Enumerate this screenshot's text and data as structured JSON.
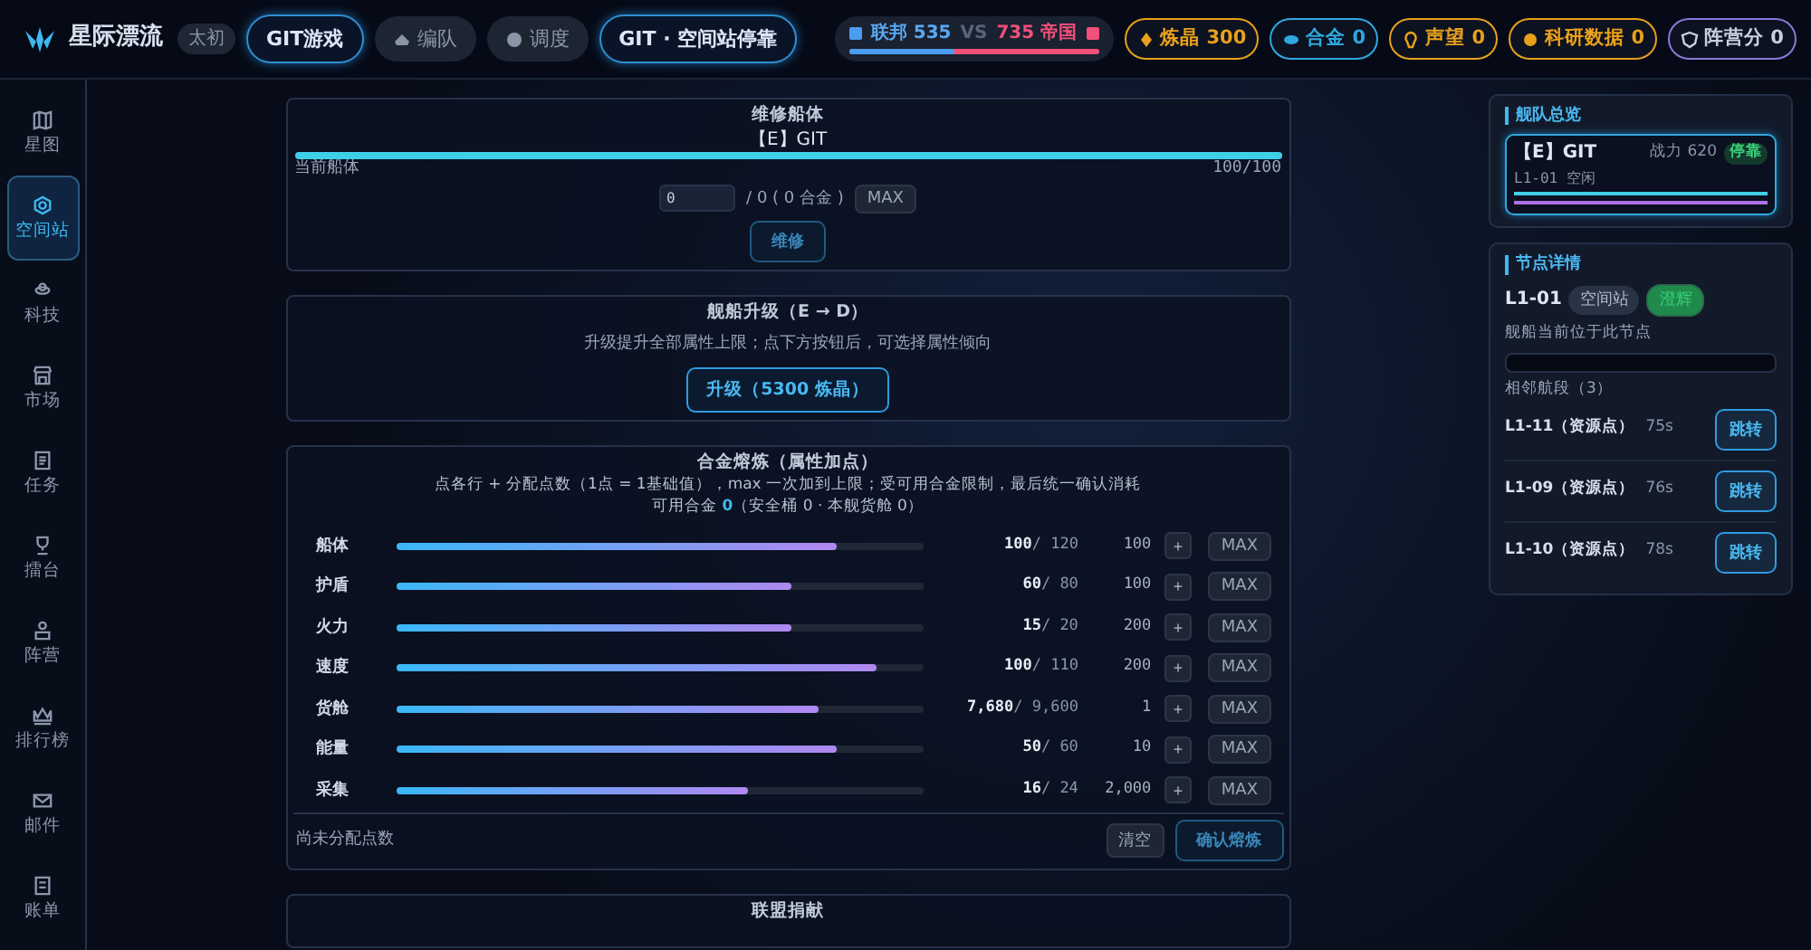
{
  "header": {
    "brand": "星际漂流",
    "era": "太初",
    "game_button": "GIT游戏",
    "nav": [
      {
        "kind": "fleet",
        "label": "编队"
      },
      {
        "kind": "dispatch",
        "label": "调度"
      }
    ],
    "location_button": "GIT · 空间站停靠",
    "faction": {
      "left_name": "联邦",
      "left_score": "535",
      "vs": "VS",
      "right_score": "735",
      "right_name": "帝国",
      "level": 0.42
    },
    "resources": [
      {
        "kind": "crystal",
        "label": "炼晶",
        "value": "300",
        "color": "#e8a01c"
      },
      {
        "kind": "alloy",
        "label": "合金",
        "value": "0",
        "color": "#2fa8e0"
      },
      {
        "kind": "fame",
        "label": "声望",
        "value": "0",
        "color": "#e8a01c"
      },
      {
        "kind": "research",
        "label": "科研数据",
        "value": "0",
        "color": "#e8a01c"
      },
      {
        "kind": "faction",
        "label": "阵营分",
        "value": "0",
        "color": "#8a78d8"
      }
    ]
  },
  "sidebar": {
    "items": [
      {
        "kind": "map",
        "label": "星图",
        "selected": false
      },
      {
        "kind": "station",
        "label": "空间站",
        "selected": true
      },
      {
        "kind": "tech",
        "label": "科技",
        "selected": false
      },
      {
        "kind": "market",
        "label": "市场",
        "selected": false
      },
      {
        "kind": "task",
        "label": "任务",
        "selected": false
      },
      {
        "kind": "trophy",
        "label": "擂台",
        "selected": false
      },
      {
        "kind": "camp",
        "label": "阵营",
        "selected": false
      },
      {
        "kind": "crown",
        "label": "排行榜",
        "selected": false
      },
      {
        "kind": "mail",
        "label": "邮件",
        "selected": false
      },
      {
        "kind": "bill",
        "label": "账单",
        "selected": false
      }
    ]
  },
  "repair": {
    "title": "维修船体",
    "ship": "【E】GIT",
    "level": 1,
    "hull_label": "当前船体",
    "hull_value": "100/100",
    "input_value": "0",
    "cost": "/ 0 ( 0 合金 )",
    "max_button": "MAX",
    "repair_button": "维修"
  },
  "upgrade": {
    "title": "舰船升级（E → D）",
    "description": "升级提升全部属性上限；点下方按钮后，可选择属性倾向",
    "button": "升级（5300 炼晶）"
  },
  "smelt": {
    "title": "合金熔炼（属性加点）",
    "description": "点各行 + 分配点数（1点 = 1基础值），max 一次加到上限；受可用合金限制，最后统一确认消耗",
    "available": "可用合金 **0**（安全桶 0 · 本舰货舱 0）",
    "rows": [
      {
        "name": "船体",
        "level": 0.835,
        "value": "100",
        "max": "/ 120",
        "cost": "100",
        "plus": "+",
        "max_button": "MAX"
      },
      {
        "name": "护盾",
        "level": 0.75,
        "value": "60",
        "max": "/ 80",
        "cost": "100",
        "plus": "+",
        "max_button": "MAX"
      },
      {
        "name": "火力",
        "level": 0.75,
        "value": "15",
        "max": "/ 20",
        "cost": "200",
        "plus": "+",
        "max_button": "MAX"
      },
      {
        "name": "速度",
        "level": 0.91,
        "value": "100",
        "max": "/ 110",
        "cost": "200",
        "plus": "+",
        "max_button": "MAX"
      },
      {
        "name": "货舱",
        "level": 0.8,
        "value": "7,680",
        "max": "/ 9,600",
        "cost": "1",
        "plus": "+",
        "max_button": "MAX"
      },
      {
        "name": "能量",
        "level": 0.835,
        "value": "50",
        "max": "/ 60",
        "cost": "10",
        "plus": "+",
        "max_button": "MAX"
      },
      {
        "name": "采集",
        "level": 0.667,
        "value": "16",
        "max": "/ 24",
        "cost": "2,000",
        "plus": "+",
        "max_button": "MAX"
      }
    ],
    "unassigned": "尚未分配点数",
    "clear_button": "清空",
    "confirm_button": "确认熔炼"
  },
  "donation": {
    "title": "联盟捐献"
  },
  "fleet": {
    "title": "舰队总览",
    "ship": "【E】GIT",
    "power": "战力 620",
    "status": "停靠",
    "location": "L1-01 空闲",
    "bars": [
      {
        "level": 1,
        "color": "#3fd0e8"
      },
      {
        "level": 1,
        "color": "#b070e8"
      }
    ]
  },
  "node": {
    "title": "节点详情",
    "id": "L1-01",
    "tags": [
      {
        "label": "空间站",
        "color": "#2a3346"
      },
      {
        "label": "澄辉",
        "color": "#1f8a4c"
      }
    ],
    "note": "舰船当前位于此节点",
    "level": 0,
    "routes_title": "相邻航段（3）",
    "routes": [
      {
        "name": "L1-11（资源点）",
        "time": "75s",
        "button": "跳转"
      },
      {
        "name": "L1-09（资源点）",
        "time": "76s",
        "button": "跳转"
      },
      {
        "name": "L1-10（资源点）",
        "time": "78s",
        "button": "跳转"
      }
    ]
  }
}
